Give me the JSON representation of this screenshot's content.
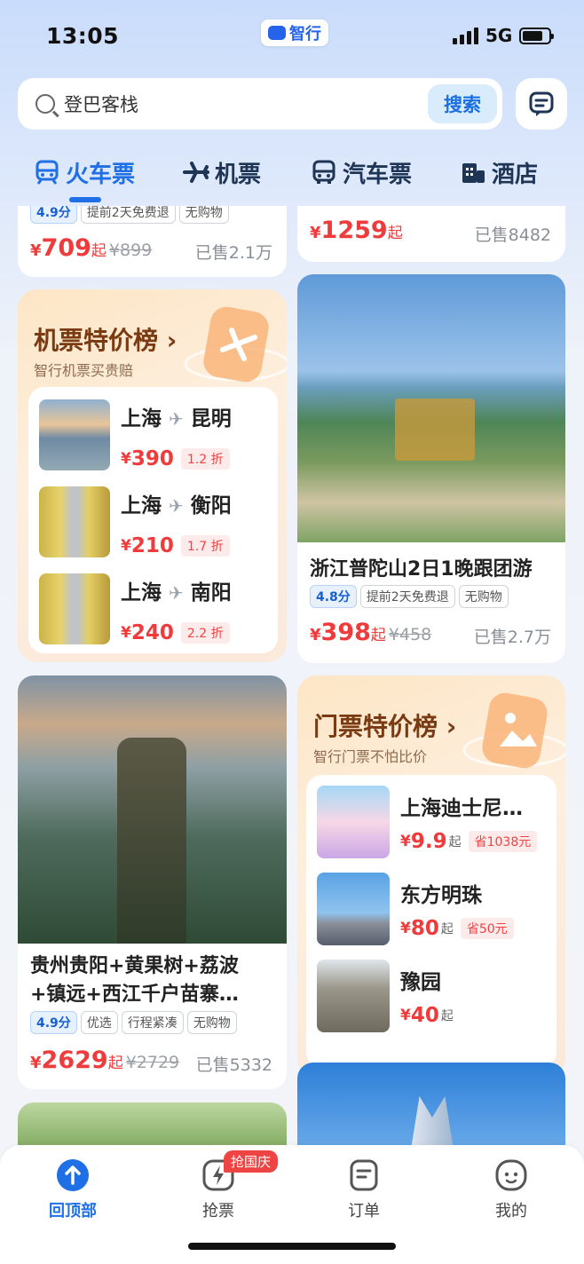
{
  "status_bar": {
    "time": "13:05",
    "app_badge": "智行",
    "network": "5G"
  },
  "search": {
    "query": "登巴客栈",
    "button": "搜索"
  },
  "tabs": [
    {
      "label": "火车票",
      "icon": "train-icon",
      "active": true
    },
    {
      "label": "机票",
      "icon": "plane-icon",
      "active": false
    },
    {
      "label": "汽车票",
      "icon": "bus-icon",
      "active": false
    },
    {
      "label": "酒店",
      "icon": "hotel-icon",
      "active": false
    }
  ],
  "feed": {
    "top_left": {
      "score": "4.9分",
      "tags": [
        "提前2天免费退",
        "无购物"
      ],
      "currency": "¥",
      "price": "709",
      "suffix": "起",
      "original": "¥899",
      "sold": "已售2.1万"
    },
    "top_right": {
      "currency": "¥",
      "price": "1259",
      "suffix": "起",
      "sold": "已售8482"
    },
    "flight_rank": {
      "title": "机票特价榜",
      "arrow": "›",
      "subtitle": "智行机票买贵赔",
      "items": [
        {
          "from": "上海",
          "to": "昆明",
          "currency": "¥",
          "price": "390",
          "discount": "1.2 折"
        },
        {
          "from": "上海",
          "to": "衡阳",
          "currency": "¥",
          "price": "210",
          "discount": "1.7 折"
        },
        {
          "from": "上海",
          "to": "南阳",
          "currency": "¥",
          "price": "240",
          "discount": "2.2 折"
        }
      ]
    },
    "putuo": {
      "title": "浙江普陀山2日1晚跟团游",
      "score": "4.8分",
      "tags": [
        "提前2天免费退",
        "无购物"
      ],
      "currency": "¥",
      "price": "398",
      "suffix": "起",
      "original": "¥458",
      "sold": "已售2.7万"
    },
    "guizhou": {
      "title": "贵州贵阳+黄果树+荔波+镇远+西江千户苗寨…",
      "score": "4.9分",
      "tags": [
        "优选",
        "行程紧凑",
        "无购物"
      ],
      "currency": "¥",
      "price": "2629",
      "suffix": "起",
      "original": "¥2729",
      "sold": "已售5332"
    },
    "ticket_rank": {
      "title": "门票特价榜",
      "arrow": "›",
      "subtitle": "智行门票不怕比价",
      "items": [
        {
          "name": "上海迪士尼…",
          "currency": "¥",
          "price": "9.9",
          "suffix": "起",
          "save": "省1038元"
        },
        {
          "name": "东方明珠",
          "currency": "¥",
          "price": "80",
          "suffix": "起",
          "save": "省50元"
        },
        {
          "name": "豫园",
          "currency": "¥",
          "price": "40",
          "suffix": "起",
          "save": ""
        }
      ]
    }
  },
  "bottom_nav": [
    {
      "label": "回顶部",
      "active": true
    },
    {
      "label": "抢票",
      "active": false,
      "badge": "抢国庆"
    },
    {
      "label": "订单",
      "active": false
    },
    {
      "label": "我的",
      "active": false
    }
  ],
  "colors": {
    "accent": "#1f6fe6",
    "price": "#ef3b3b",
    "rank_title": "#7a3a12"
  }
}
